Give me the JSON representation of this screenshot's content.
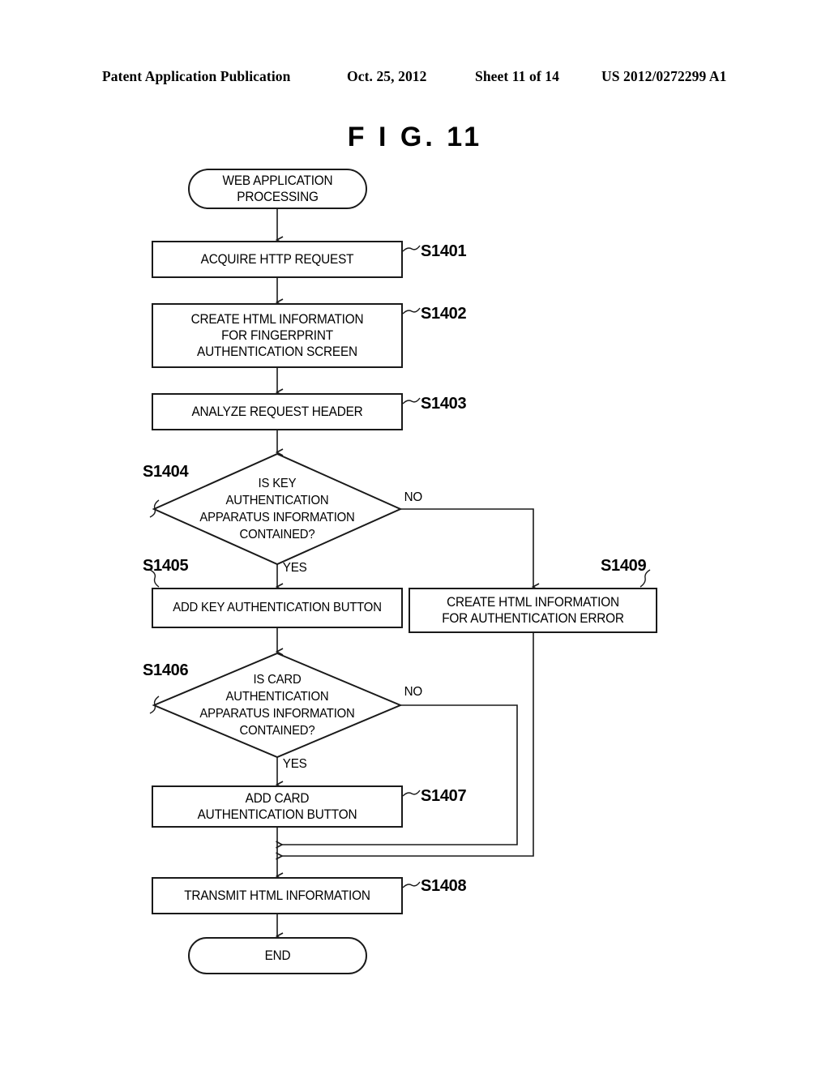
{
  "header": {
    "publication": "Patent Application Publication",
    "date": "Oct. 25, 2012",
    "sheet": "Sheet 11 of 14",
    "patent_number": "US 2012/0272299 A1"
  },
  "figure": {
    "title": "F I G.  11"
  },
  "flowchart": {
    "nodes": {
      "start": {
        "label": "WEB APPLICATION\nPROCESSING",
        "shape": "terminal"
      },
      "s1401": {
        "ref": "S1401",
        "label": "ACQUIRE HTTP REQUEST",
        "shape": "process"
      },
      "s1402": {
        "ref": "S1402",
        "label": "CREATE HTML INFORMATION\nFOR FINGERPRINT\nAUTHENTICATION SCREEN",
        "shape": "process"
      },
      "s1403": {
        "ref": "S1403",
        "label": "ANALYZE REQUEST HEADER",
        "shape": "process"
      },
      "s1404": {
        "ref": "S1404",
        "label": "IS KEY\nAUTHENTICATION\nAPPARATUS INFORMATION\nCONTAINED?",
        "shape": "decision"
      },
      "s1405": {
        "ref": "S1405",
        "label": "ADD KEY AUTHENTICATION BUTTON",
        "shape": "process"
      },
      "s1409": {
        "ref": "S1409",
        "label": "CREATE HTML INFORMATION\nFOR AUTHENTICATION ERROR",
        "shape": "process"
      },
      "s1406": {
        "ref": "S1406",
        "label": "IS CARD\nAUTHENTICATION\nAPPARATUS INFORMATION\nCONTAINED?",
        "shape": "decision"
      },
      "s1407": {
        "ref": "S1407",
        "label": "ADD CARD\nAUTHENTICATION BUTTON",
        "shape": "process"
      },
      "s1408": {
        "ref": "S1408",
        "label": "TRANSMIT HTML INFORMATION",
        "shape": "process"
      },
      "end": {
        "label": "END",
        "shape": "terminal"
      }
    },
    "branches": {
      "s1404_no": "NO",
      "s1404_yes": "YES",
      "s1406_no": "NO",
      "s1406_yes": "YES"
    },
    "colors": {
      "line": "#1a1a1a",
      "text": "#000000",
      "background": "#ffffff"
    }
  }
}
